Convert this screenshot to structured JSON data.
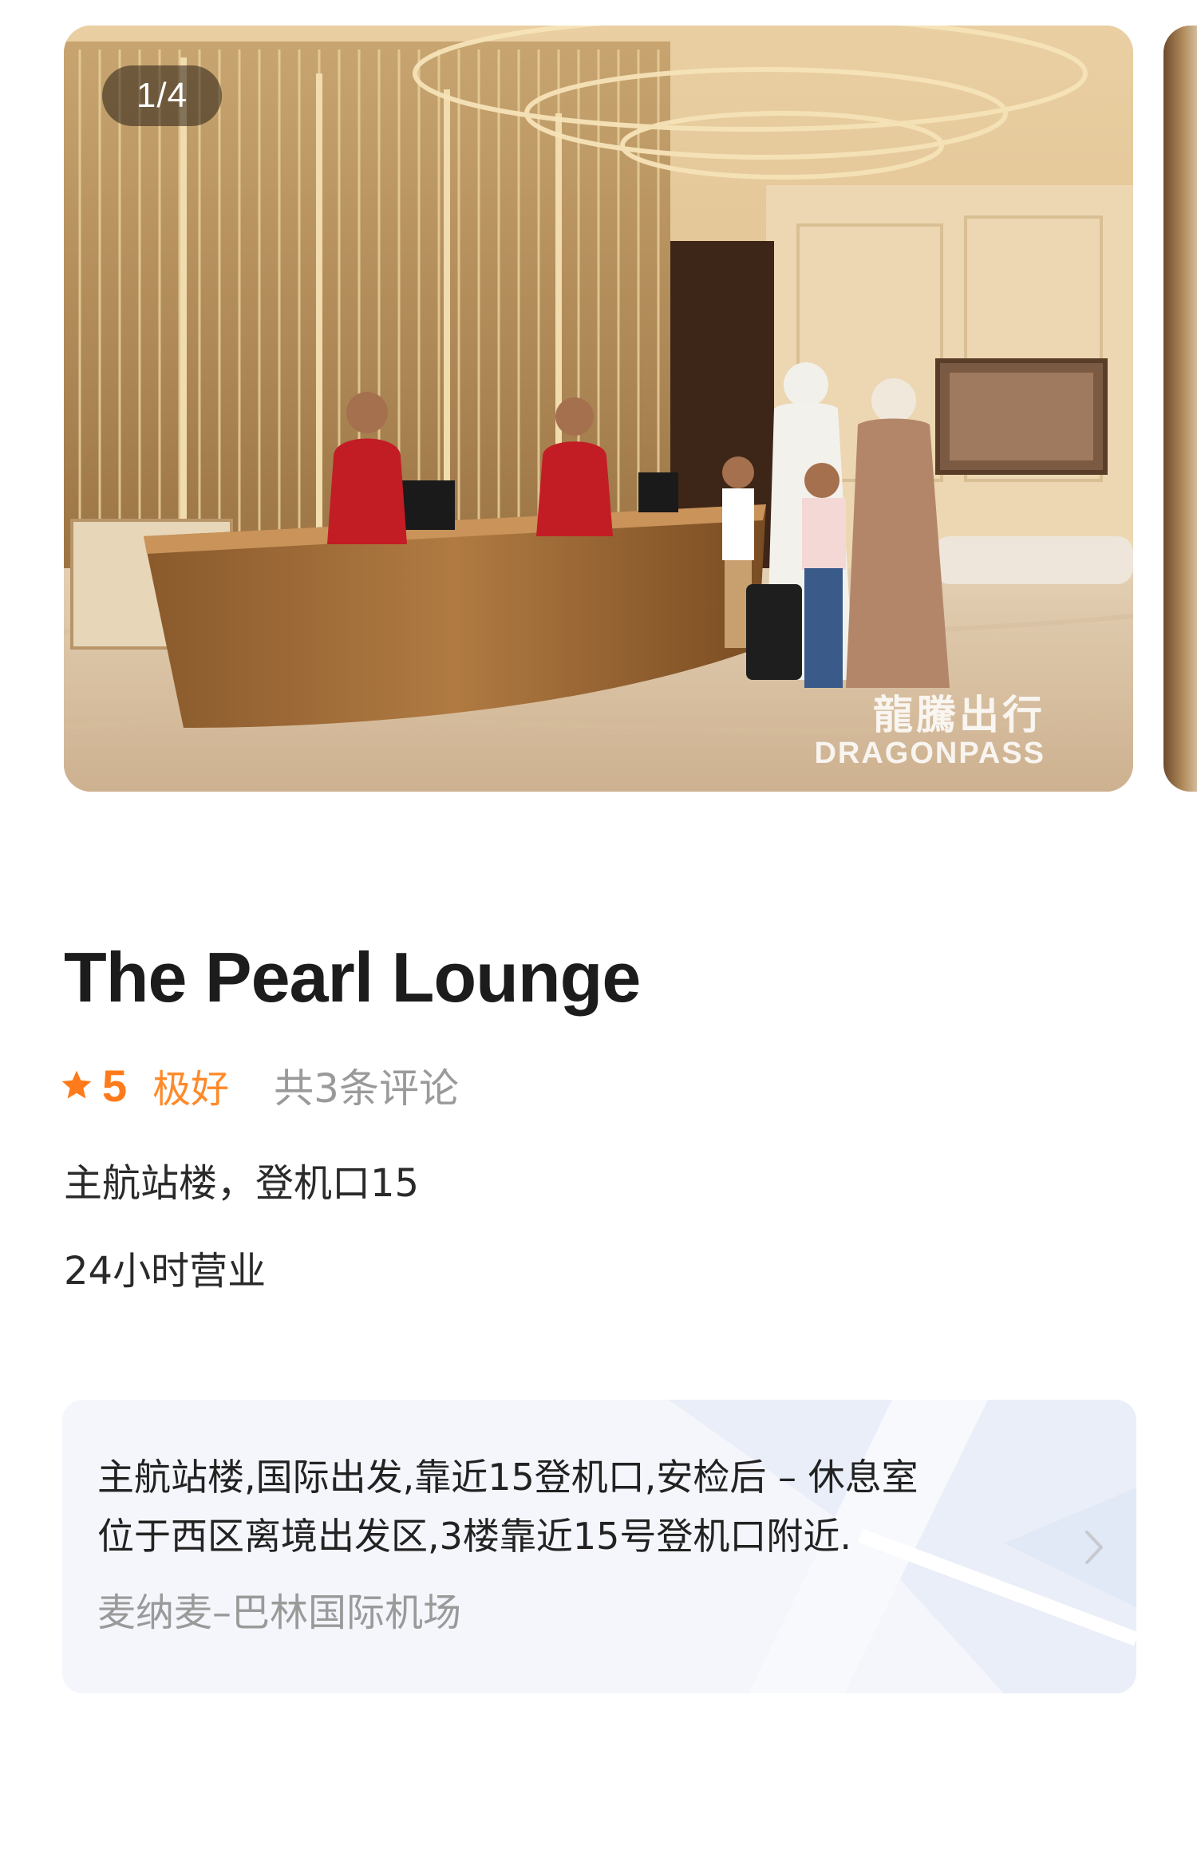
{
  "gallery": {
    "counter": "1/4",
    "watermark_cn": "龍騰出行",
    "watermark_en": "DRAGONPASS"
  },
  "lounge": {
    "name": "The Pearl Lounge",
    "rating": {
      "score": "5",
      "grade": "极好",
      "reviews": "共3条评论"
    },
    "location": "主航站楼，登机口15",
    "hours": "24小时营业"
  },
  "address_card": {
    "line1": "主航站楼,国际出发,靠近15登机口,安检后 – 休息室",
    "line2": "位于西区离境出发区,3楼靠近15号登机口附近.",
    "airport": "麦纳麦–巴林国际机场"
  },
  "colors": {
    "accent": "#ff7a1a",
    "muted": "#9a9a9a",
    "card_bg": "#f4f6fb"
  },
  "icons": {
    "rating": "star-icon",
    "more": "chevron-right-icon"
  }
}
